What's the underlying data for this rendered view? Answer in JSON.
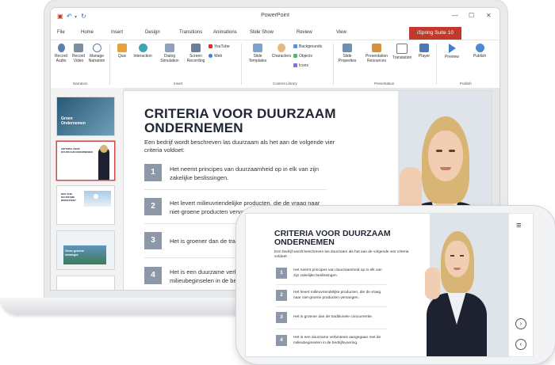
{
  "window": {
    "title": "PowerPoint",
    "minimize": "—",
    "maximize": "☐",
    "close": "✕"
  },
  "tabs": [
    "File",
    "Home",
    "Insert",
    "Design",
    "Transitions",
    "Animations",
    "Slide Show",
    "Review",
    "View"
  ],
  "active_tab": "iSpring Suite 10",
  "ribbon": {
    "narration": {
      "label": "Narration",
      "items": [
        "Record Audio",
        "Record Video",
        "Manage Narration"
      ]
    },
    "insert": {
      "label": "Insert",
      "items": [
        "Quiz",
        "Interaction",
        "Dialog Simulation",
        "Screen Recording"
      ],
      "small": [
        "YouTube",
        "Web"
      ]
    },
    "content_library": {
      "label": "Content Library",
      "items": [
        "Slide Templates",
        "Characters"
      ],
      "small": [
        "Backgrounds",
        "Objects",
        "Icons"
      ]
    },
    "presentation": {
      "label": "Presentation",
      "items": [
        "Slide Properties",
        "Presentation Resources",
        "Translation",
        "Player"
      ]
    },
    "publish": {
      "label": "Publish",
      "items": [
        "Preview",
        "Publish"
      ]
    }
  },
  "thumbnails": {
    "t1": {
      "line1": "Groen",
      "line2": "Ondernemen"
    },
    "t2": {
      "title": "CRITERIA VOOR DUURZAAM ONDERNEMEN"
    },
    "t3": {
      "title": "WAT ZIJN DUURZAME BEDRIJVEN?"
    },
    "t4": {
      "title": "Onze groene strategie"
    }
  },
  "slide": {
    "title": "CRITERIA VOOR DUURZAAM ONDERNEMEN",
    "intro": "Een bedrijf wordt beschreven las duurzaam als het aan de volgende vier criteria voldoet:",
    "criteria": [
      {
        "num": "1",
        "text": "Het neemt principes van duurzaamheid op in elk van zijn zakelijke beslissingen."
      },
      {
        "num": "2",
        "text": "Het levert milieuvriendelijke producten, die de vraag naar niet-groene producten vervangen."
      },
      {
        "num": "3",
        "text": "Het is groener dan de traditionele concurrentie."
      },
      {
        "num": "4",
        "text": "Het is een duurzame verbintenis aangegaan met de milieubeginselen in de bedrijfsvoering."
      }
    ]
  },
  "phone": {
    "title": "CRITERIA VOOR DUURZAAM ONDERNEMEN",
    "intro": "Een bedrijf wordt beschreven las duurzaam als het aan de volgende vier criteria voldoet:",
    "criteria": [
      {
        "num": "1",
        "text": "Het neemt principes van duurzaamheid op in elk van zijn zakelijke beslissingen."
      },
      {
        "num": "2",
        "text": "Het levert milieuvriendelijke producten, die de vraag naar niet-groene producten vervangen."
      },
      {
        "num": "3",
        "text": "Het is groener dan de traditionele concurrentie."
      },
      {
        "num": "4",
        "text": "Het is een duurzame verbintenis aangegaan met de milieubeginselen in de bedrijfsvoering."
      }
    ],
    "menu_icon": "menu-icon",
    "next_icon": "chevron-right-icon",
    "prev_icon": "chevron-left-icon"
  },
  "colors": {
    "accent": "#c0392b",
    "badge": "#8c97a7",
    "title": "#1f2633"
  }
}
